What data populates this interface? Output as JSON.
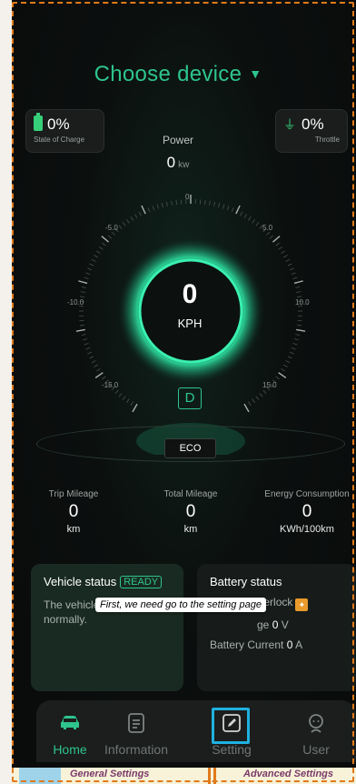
{
  "header": {
    "device_select": "Choose device"
  },
  "soc": {
    "value": "0%",
    "label": "State of Charge"
  },
  "throttle": {
    "value": "0%",
    "label": "Throttle"
  },
  "power": {
    "label": "Power",
    "value": "0",
    "unit": "kw"
  },
  "gauge": {
    "ticks": [
      "0",
      "-5.0",
      "5.0",
      "-10.0",
      "10.0",
      "-15.0",
      "15.0"
    ],
    "speed": "0",
    "speed_unit": "KPH",
    "gear": "D",
    "mode": "ECO"
  },
  "stats": [
    {
      "label": "Trip Mileage",
      "value": "0",
      "unit": "km"
    },
    {
      "label": "Total Mileage",
      "value": "0",
      "unit": "km"
    },
    {
      "label": "Energy Consumption",
      "value": "0",
      "unit": "KWh/100km"
    }
  ],
  "vehicle_status": {
    "title": "Vehicle status",
    "badge": "READY",
    "text": "The vehicle is running normally."
  },
  "battery_status": {
    "title": "Battery status",
    "interlock_label": "Charger interlock",
    "voltage_label": "Battery Voltage",
    "voltage_visible_fragment": "ge",
    "voltage_value": "0",
    "voltage_unit": "V",
    "current_label": "Battery Current",
    "current_value": "0",
    "current_unit": "A"
  },
  "tooltip": "First, we need go to the setting page",
  "nav": [
    {
      "label": "Home",
      "icon": "car-icon"
    },
    {
      "label": "Information",
      "icon": "document-icon"
    },
    {
      "label": "Setting",
      "icon": "edit-icon"
    },
    {
      "label": "User",
      "icon": "user-icon"
    }
  ],
  "bottom_tabs": [
    "General Settings",
    "Advanced Settings"
  ],
  "colors": {
    "accent": "#2ec48d",
    "highlight": "#1fb1e0",
    "border": "#e07a1c"
  }
}
